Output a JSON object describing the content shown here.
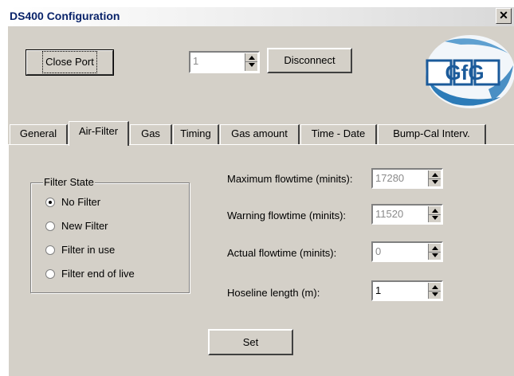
{
  "window": {
    "title": "DS400 Configuration",
    "close_glyph": "✕"
  },
  "toolbar": {
    "close_port_label": "Close Port",
    "port_value": "1",
    "disconnect_label": "Disconnect"
  },
  "logo": {
    "text": "GfG",
    "colors": {
      "globe": "#2c7bb8",
      "letters": "#1a5a9a"
    }
  },
  "tabs": [
    {
      "label": "General"
    },
    {
      "label": "Air-Filter",
      "active": true
    },
    {
      "label": "Gas"
    },
    {
      "label": "Timing"
    },
    {
      "label": "Gas amount"
    },
    {
      "label": "Time - Date"
    },
    {
      "label": "Bump-Cal Interv."
    }
  ],
  "filter_state": {
    "title": "Filter State",
    "options": [
      {
        "label": "No Filter",
        "selected": true
      },
      {
        "label": "New Filter",
        "selected": false
      },
      {
        "label": "Filter in use",
        "selected": false
      },
      {
        "label": "Filter end of live",
        "selected": false
      }
    ]
  },
  "fields": [
    {
      "label": "Maximum flowtime (minits):",
      "value": "17280",
      "enabled": false
    },
    {
      "label": "Warning flowtime (minits):",
      "value": "11520",
      "enabled": false
    },
    {
      "label": "Actual flowtime (minits):",
      "value": "0",
      "enabled": false
    },
    {
      "label": "Hoseline length (m):",
      "value": "1",
      "enabled": true
    }
  ],
  "set_button_label": "Set"
}
